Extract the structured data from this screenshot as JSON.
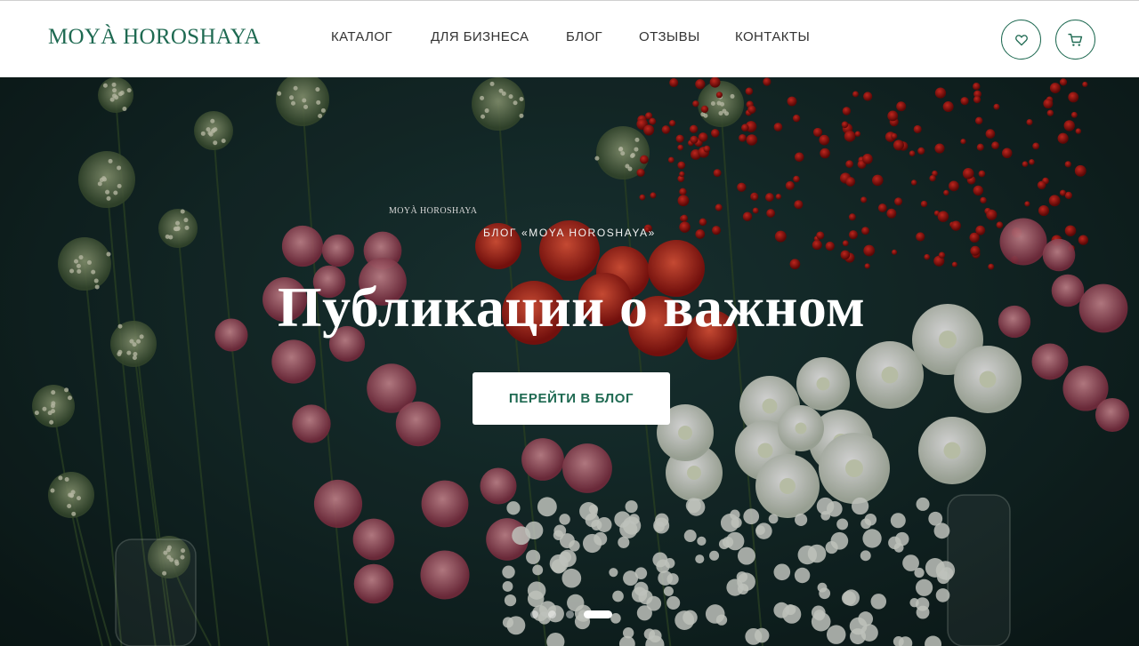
{
  "header": {
    "logo": "MOYÀ HOROSHAYA",
    "nav": [
      "КАТАЛОГ",
      "ДЛЯ БИЗНЕСА",
      "БЛОГ",
      "ОТЗЫВЫ",
      "КОНТАКТЫ"
    ],
    "icons": [
      "heart-icon",
      "cart-icon"
    ]
  },
  "hero": {
    "vase_brand": "MOYÀ HOROSHAYA",
    "eyebrow": "БЛОГ «MOYA HOROSHAYA»",
    "title": "Публикации о важном",
    "cta_label": "ПЕРЕЙТИ В БЛОГ",
    "slides": {
      "count": 4,
      "active_index": 4
    }
  },
  "colors": {
    "brand_green": "#1f6a52",
    "nav_text": "#333333",
    "hero_background": "#142a29"
  }
}
